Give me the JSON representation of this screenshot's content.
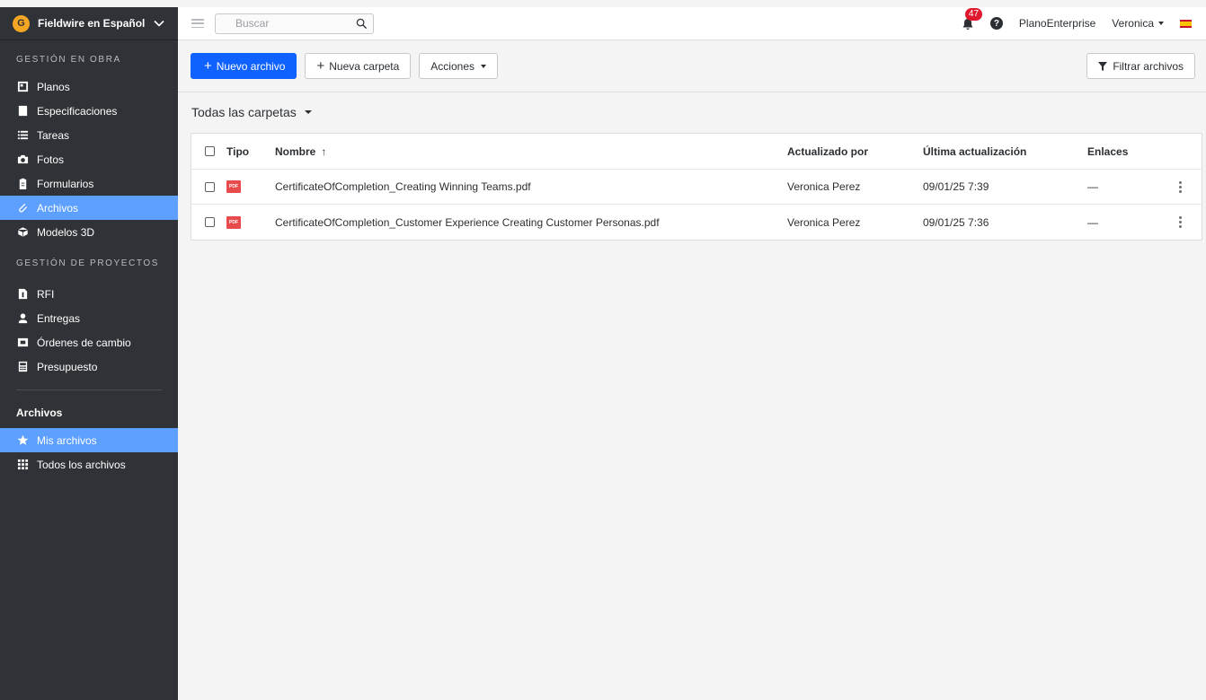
{
  "sidebar": {
    "project_name": "Fieldwire en Español",
    "logo_letter": "G",
    "section_obra": "GESTIÓN EN OBRA",
    "obra_items": [
      {
        "label": "Planos",
        "icon": "plans-icon"
      },
      {
        "label": "Especificaciones",
        "icon": "specs-icon"
      },
      {
        "label": "Tareas",
        "icon": "tasks-icon"
      },
      {
        "label": "Fotos",
        "icon": "camera-icon"
      },
      {
        "label": "Formularios",
        "icon": "clipboard-icon"
      },
      {
        "label": "Archivos",
        "icon": "paperclip-icon"
      },
      {
        "label": "Modelos 3D",
        "icon": "cube-icon"
      }
    ],
    "section_proyectos": "GESTIÓN DE PROYECTOS",
    "proyecto_items": [
      {
        "label": "RFI",
        "icon": "info-doc-icon"
      },
      {
        "label": "Entregas",
        "icon": "person-icon"
      },
      {
        "label": "Órdenes de cambio",
        "icon": "change-order-icon"
      },
      {
        "label": "Presupuesto",
        "icon": "calculator-icon"
      }
    ],
    "files_heading": "Archivos",
    "files_items": [
      {
        "label": "Mis archivos",
        "icon": "star-icon"
      },
      {
        "label": "Todos los archivos",
        "icon": "grid-icon"
      }
    ]
  },
  "topbar": {
    "search_placeholder": "Buscar",
    "notification_count": "47",
    "help": "?",
    "plan": "PlanoEnterprise",
    "user": "Veronica"
  },
  "toolbar": {
    "new_file": "Nuevo archivo",
    "new_folder": "Nueva carpeta",
    "actions": "Acciones",
    "filter": "Filtrar archivos"
  },
  "folder": {
    "title": "Todas las carpetas"
  },
  "table": {
    "headers": {
      "type": "Tipo",
      "name": "Nombre",
      "sort_arrow": "↑",
      "updated_by": "Actualizado por",
      "last_update": "Última actualización",
      "links": "Enlaces"
    },
    "rows": [
      {
        "type": "PDF",
        "name": "CertificateOfCompletion_Creating Winning Teams.pdf",
        "updated_by": "Veronica Perez",
        "last_update": "09/01/25 7:39",
        "links": "—"
      },
      {
        "type": "PDF",
        "name": "CertificateOfCompletion_Customer Experience Creating Customer Personas.pdf",
        "updated_by": "Veronica Perez",
        "last_update": "09/01/25 7:36",
        "links": "—"
      }
    ]
  },
  "colors": {
    "sidebar_bg": "#2f3236",
    "active_bg": "#5ea0ff",
    "primary": "#0f62fe",
    "pdf": "#e84b4b",
    "badge": "#e0182d"
  }
}
